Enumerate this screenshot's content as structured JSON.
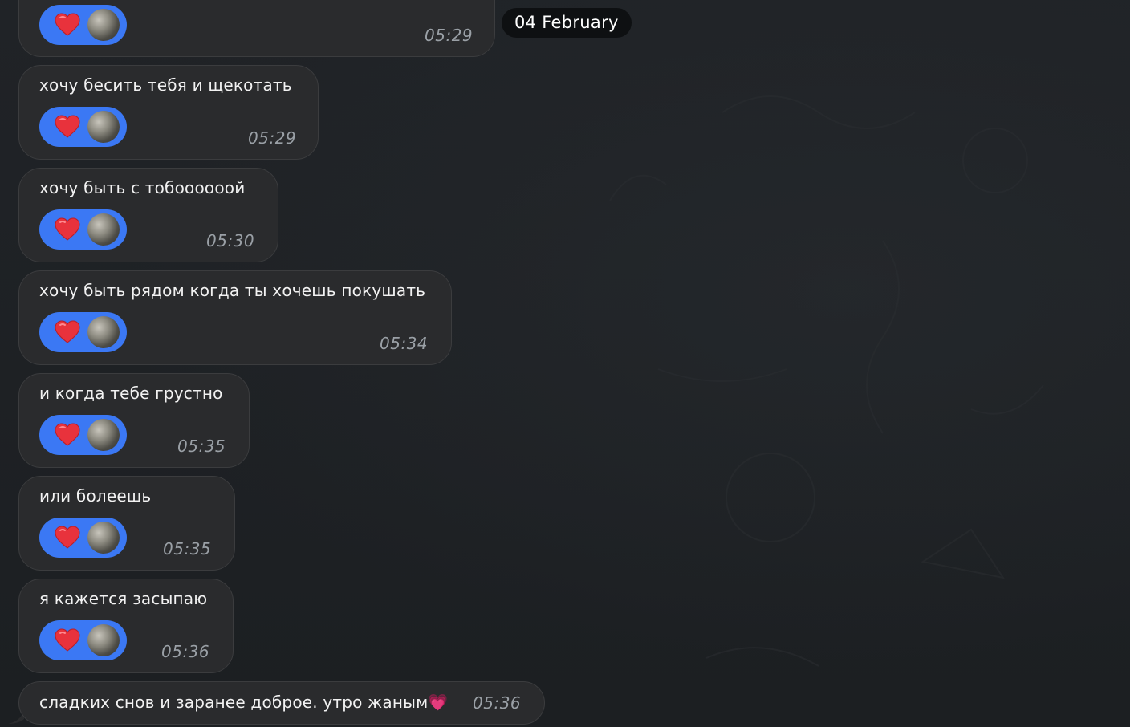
{
  "date_separator": "04 February",
  "messages": [
    {
      "text": "",
      "time": "05:29",
      "reaction": "heart"
    },
    {
      "text": "хочу бесить тебя и щекотать",
      "time": "05:29",
      "reaction": "heart"
    },
    {
      "text": "хочу быть с тобоооооой",
      "time": "05:30",
      "reaction": "heart"
    },
    {
      "text": "хочу быть рядом когда ты хочешь покушать",
      "time": "05:34",
      "reaction": "heart"
    },
    {
      "text": "и когда тебе грустно",
      "time": "05:35",
      "reaction": "heart"
    },
    {
      "text": "или болеешь",
      "time": "05:35",
      "reaction": "heart"
    },
    {
      "text": "я кажется засыпаю",
      "time": "05:36",
      "reaction": "heart"
    },
    {
      "text": "сладких снов и заранее доброе. утро жаным",
      "emoji": "💗",
      "time": "05:36"
    }
  ],
  "colors": {
    "background": "#1d2024",
    "bubble": "#2a2b2d",
    "reaction_pill": "#3b78f4",
    "heart": "#e8323c",
    "timestamp": "#9aa0a6"
  },
  "icons": {
    "reaction_icon": "heart-icon",
    "reactor_avatar": "avatar"
  }
}
